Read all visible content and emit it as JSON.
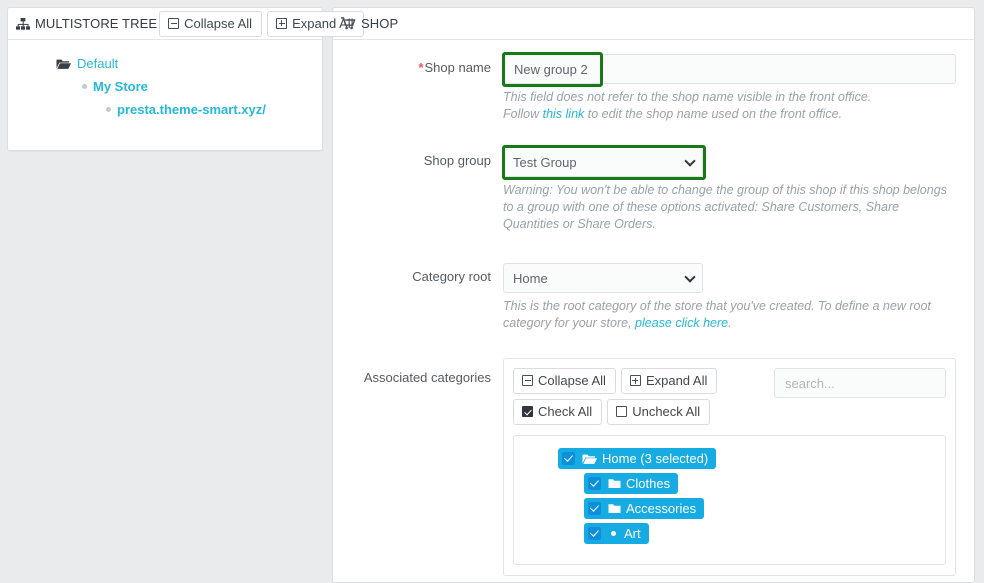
{
  "left_panel": {
    "title": "MULTISTORE TREE",
    "title_icon": "sitemap-icon",
    "collapse_all_label": "Collapse All",
    "expand_all_label": "Expand All",
    "tree": [
      {
        "label": "Default",
        "icon": "folder-open-icon",
        "bold": false,
        "level": 0
      },
      {
        "label": "My Store",
        "icon": "dot-icon",
        "bold": true,
        "level": 1
      },
      {
        "label": "presta.theme-smart.xyz/",
        "icon": "dot-icon",
        "bold": true,
        "level": 2
      }
    ],
    "link_color": "#25b9d7"
  },
  "right_panel": {
    "title": "SHOP",
    "title_icon": "shopping-cart-icon",
    "shop_name": {
      "label": "Shop name",
      "required_marker": "*",
      "value": "New group 2",
      "help_line1": "This field does not refer to the shop name visible in the front office.",
      "help_line2_pre": "Follow ",
      "help_line2_link": "this link",
      "help_line2_post": " to edit the shop name used on the front office.",
      "highlighted": true
    },
    "shop_group": {
      "label": "Shop group",
      "selected": "Test Group",
      "options": [
        "Test Group"
      ],
      "help": "Warning: You won't be able to change the group of this shop if this shop belongs to a group with one of these options activated: Share Customers, Share Quantities or Share Orders.",
      "highlighted": true
    },
    "category_root": {
      "label": "Category root",
      "selected": "Home",
      "options": [
        "Home"
      ],
      "help_pre": "This is the root category of the store that you've created. To define a new root category for your store, ",
      "help_link": "please click here",
      "help_post": "."
    },
    "associated_categories": {
      "label": "Associated categories",
      "collapse_all_label": "Collapse All",
      "expand_all_label": "Expand All",
      "check_all_label": "Check All",
      "uncheck_all_label": "Uncheck All",
      "search_placeholder": "search...",
      "search_value": "",
      "tree": [
        {
          "label": "Home (3 selected)",
          "icon": "folder-open-icon",
          "checked": true,
          "depth": 0
        },
        {
          "label": "Clothes",
          "icon": "folder-icon",
          "checked": true,
          "depth": 1
        },
        {
          "label": "Accessories",
          "icon": "folder-icon",
          "checked": true,
          "depth": 1
        },
        {
          "label": "Art",
          "icon": "dot-icon",
          "checked": true,
          "depth": 1
        }
      ]
    }
  },
  "colors": {
    "highlight_green": "#177a17",
    "chip_blue": "#16ace3",
    "checkbox_blue": "#0d8fdd",
    "link_cyan": "#25b9d7",
    "required_red": "#e0596b",
    "page_bg": "#eaebec"
  }
}
